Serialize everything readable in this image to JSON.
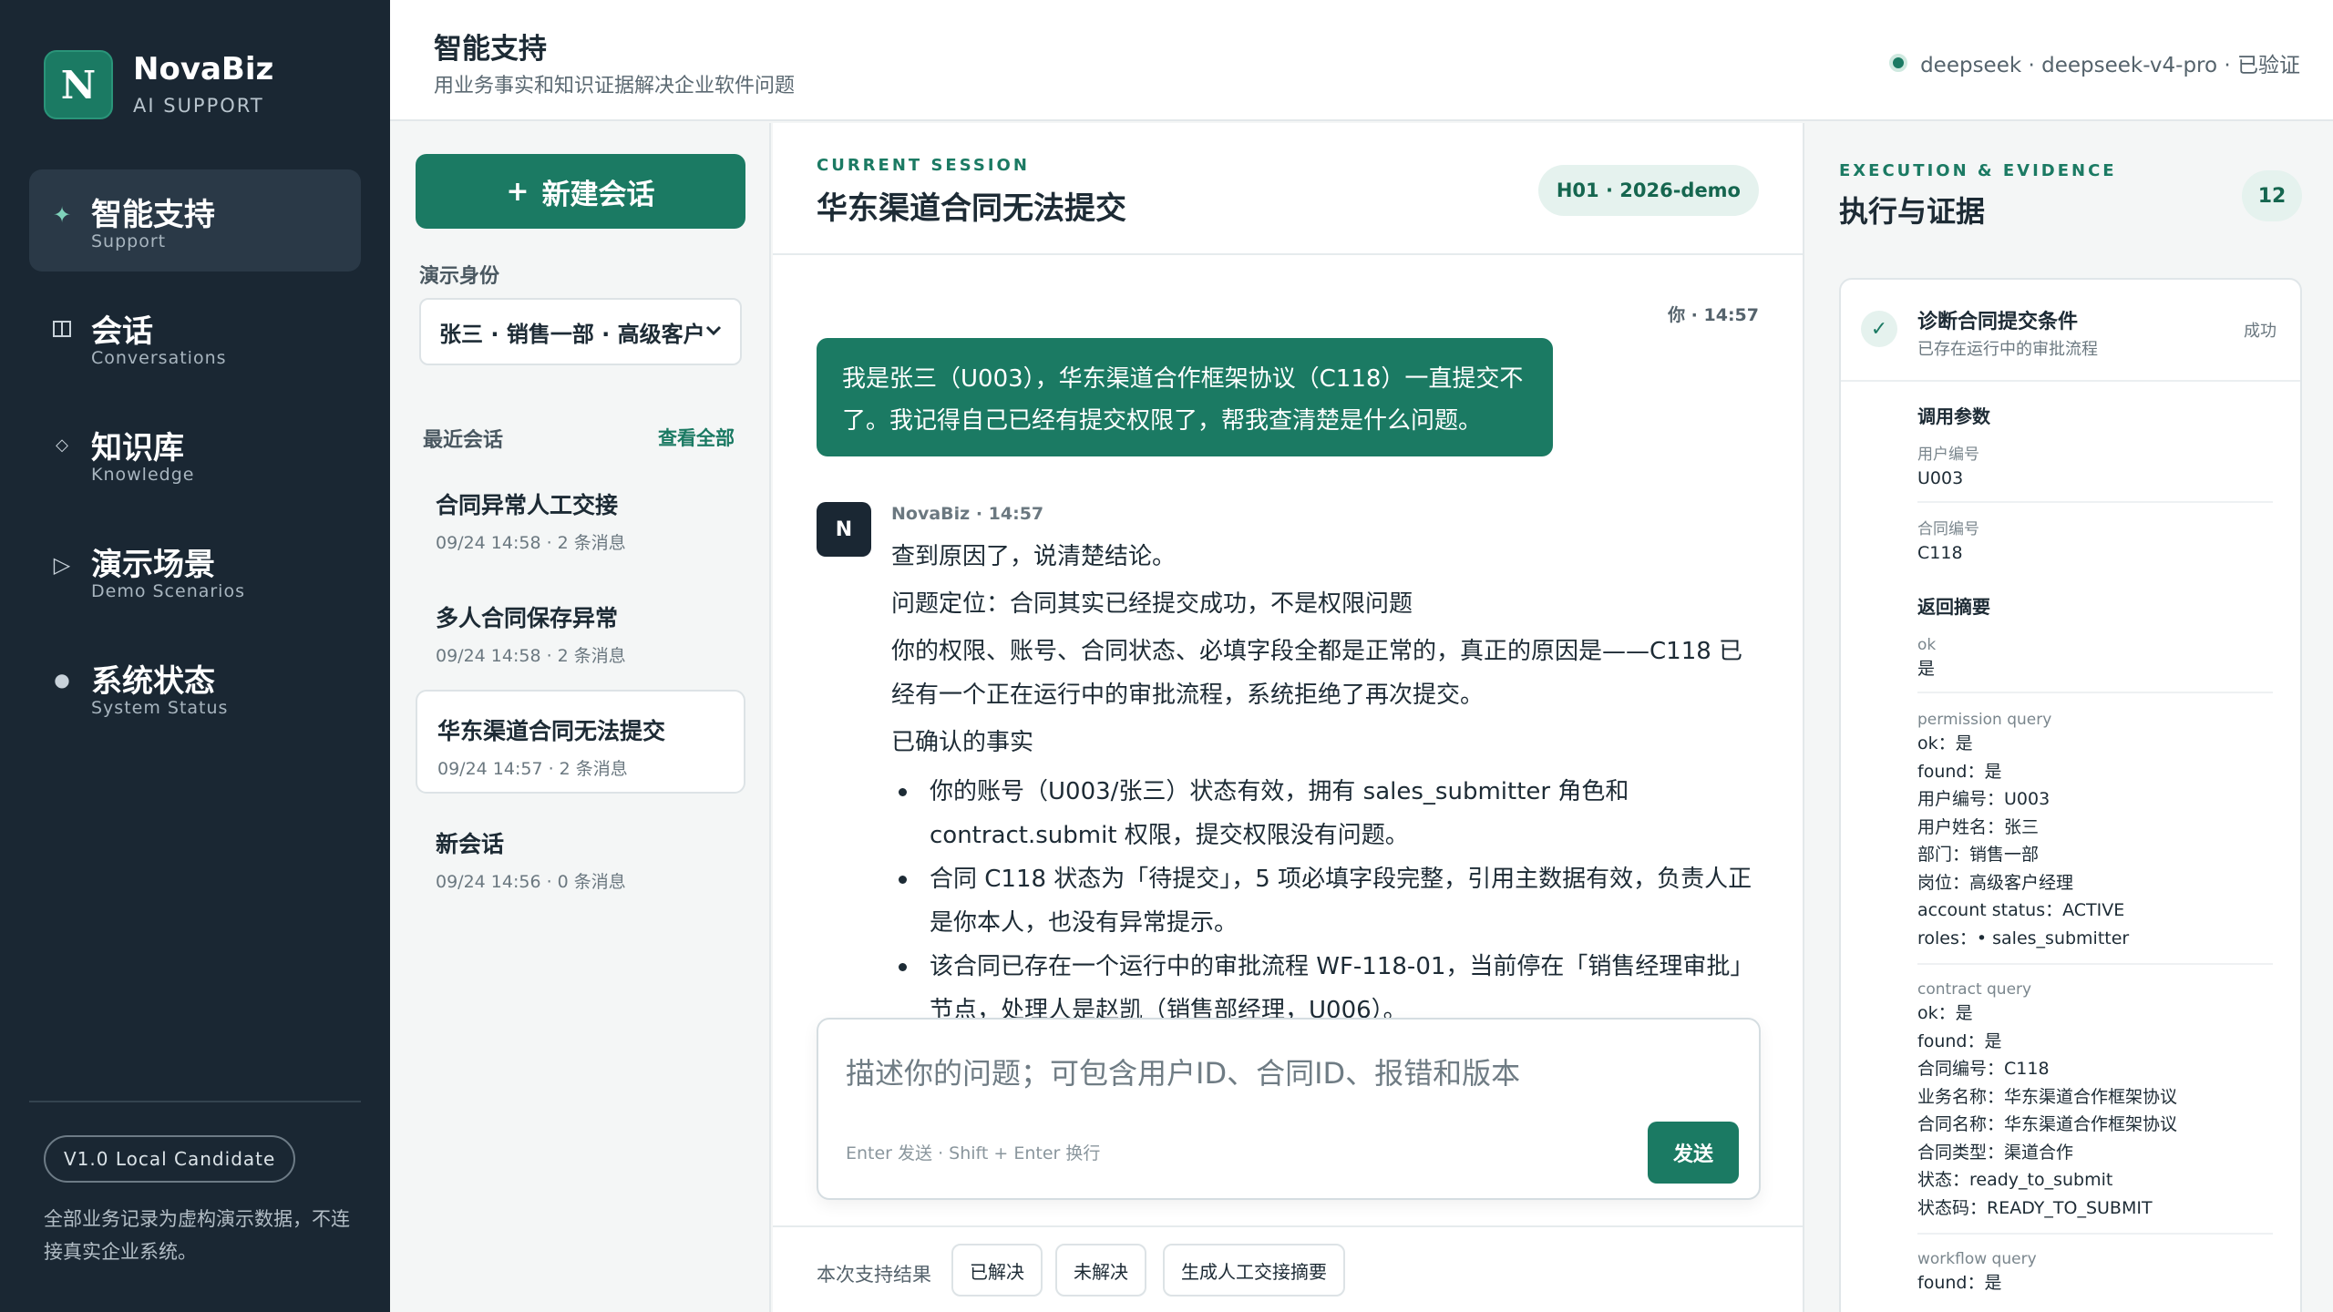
{
  "brand": {
    "logo_letter": "N",
    "name": "NovaBiz",
    "subtitle": "AI SUPPORT"
  },
  "nav": [
    {
      "label": "智能支持",
      "sub": "Support",
      "icon": "sparkle-icon",
      "active": true
    },
    {
      "label": "会话",
      "sub": "Conversations",
      "icon": "columns-icon",
      "active": false
    },
    {
      "label": "知识库",
      "sub": "Knowledge",
      "icon": "diamond-icon",
      "active": false
    },
    {
      "label": "演示场景",
      "sub": "Demo Scenarios",
      "icon": "play-icon",
      "active": false
    },
    {
      "label": "系统状态",
      "sub": "System Status",
      "icon": "dot-icon",
      "active": false
    }
  ],
  "sidebar_footer": {
    "version": "V1.0 Local Candidate",
    "note": "全部业务记录为虚构演示数据，不连接真实企业系统。"
  },
  "header": {
    "title": "智能支持",
    "subtitle": "用业务事实和知识证据解决企业软件问题",
    "model_status": "deepseek · deepseek-v4-pro · 已验证"
  },
  "sessions_panel": {
    "new_button": "新建会话",
    "demo_identity_label": "演示身份",
    "identity_value": "张三 · 销售一部 · 高级客户",
    "recent_label": "最近会话",
    "view_all": "查看全部",
    "items": [
      {
        "title": "合同异常人工交接",
        "meta": "09/24 14:58 · 2 条消息",
        "active": false
      },
      {
        "title": "多人合同保存异常",
        "meta": "09/24 14:58 · 2 条消息",
        "active": false
      },
      {
        "title": "华东渠道合同无法提交",
        "meta": "09/24 14:57 · 2 条消息",
        "active": true
      },
      {
        "title": "新会话",
        "meta": "09/24 14:56 · 0 条消息",
        "active": false
      }
    ]
  },
  "chat": {
    "eyebrow": "CURRENT SESSION",
    "title": "华东渠道合同无法提交",
    "session_tag": "H01 · 2026-demo",
    "user_meta": "你 · 14:57",
    "user_message": "我是张三（U003），华东渠道合作框架协议（C118）一直提交不了。我记得自己已经有提交权限了，帮我查清楚是什么问题。",
    "bot_avatar": "N",
    "bot_meta": "NovaBiz · 14:57",
    "bot_paragraphs": [
      "查到原因了，说清楚结论。",
      "问题定位：合同其实已经提交成功，不是权限问题",
      "你的权限、账号、合同状态、必填字段全都是正常的，真正的原因是——C118 已经有一个正在运行中的审批流程，系统拒绝了再次提交。",
      "已确认的事实"
    ],
    "bot_bullets": [
      "你的账号（U003/张三）状态有效，拥有 sales_submitter 角色和 contract.submit 权限，提交权限没有问题。",
      "合同 C118 状态为「待提交」，5 项必填字段完整，引用主数据有效，负责人正是你本人，也没有异常提示。",
      "该合同已存在一个运行中的审批流程 WF-118-01，当前停在「销售经理审批」节点，处理人是赵凯（销售部经理，U006）。"
    ],
    "composer_placeholder": "描述你的问题；可包含用户ID、合同ID、报错和版本",
    "composer_hint": "Enter 发送 · Shift + Enter 换行",
    "send_label": "发送",
    "feedback_label": "本次支持结果",
    "feedback_buttons": [
      "已解决",
      "未解决",
      "生成人工交接摘要"
    ]
  },
  "evidence": {
    "eyebrow": "EXECUTION & EVIDENCE",
    "title": "执行与证据",
    "count": "12",
    "card": {
      "title": "诊断合同提交条件",
      "subtitle": "已存在运行中的审批流程",
      "status": "成功",
      "params_heading": "调用参数",
      "params": [
        {
          "label": "用户编号",
          "value": "U003"
        },
        {
          "label": "合同编号",
          "value": "C118"
        }
      ],
      "summary_heading": "返回摘要",
      "summary_ok": {
        "label": "ok",
        "value": "是"
      },
      "blocks": [
        {
          "label": "permission query",
          "lines": [
            "ok：是",
            "found：是",
            "用户编号：U003",
            "用户姓名：张三",
            "部门：销售一部",
            "岗位：高级客户经理",
            "account status：ACTIVE",
            "roles：• sales_submitter"
          ]
        },
        {
          "label": "contract query",
          "lines": [
            "ok：是",
            "found：是",
            "合同编号：C118",
            "业务名称：华东渠道合作框架协议",
            "合同名称：华东渠道合作框架协议",
            "合同类型：渠道合作",
            "状态：ready_to_submit",
            "状态码：READY_TO_SUBMIT"
          ]
        },
        {
          "label": "workflow query",
          "lines": [
            "found：是"
          ]
        }
      ]
    }
  }
}
